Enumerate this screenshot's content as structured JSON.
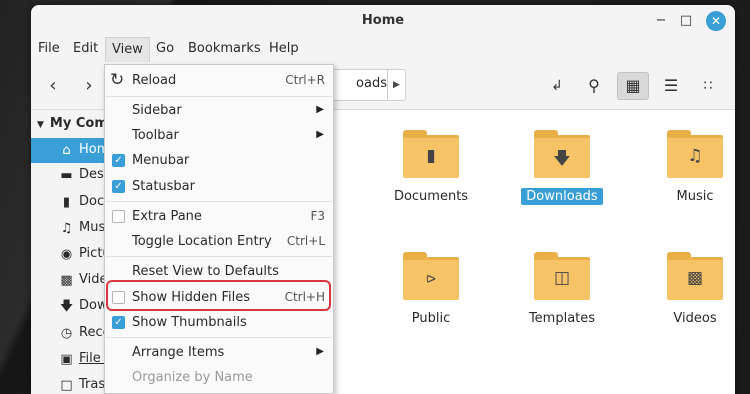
{
  "window": {
    "title": "Home"
  },
  "menubar": {
    "items": [
      "File",
      "Edit",
      "View",
      "Go",
      "Bookmarks",
      "Help"
    ]
  },
  "toolbar": {
    "back_icon": "chevron-left-icon",
    "forward_icon": "chevron-right-icon",
    "path_segment": "oads"
  },
  "sidebar": {
    "heading": "My Comp",
    "items": [
      {
        "label": "Home",
        "icon": "home-icon"
      },
      {
        "label": "Desk",
        "icon": "desktop-icon"
      },
      {
        "label": "Docu",
        "icon": "document-icon"
      },
      {
        "label": "Musi",
        "icon": "music-icon"
      },
      {
        "label": "Pictu",
        "icon": "camera-icon"
      },
      {
        "label": "Vide",
        "icon": "film-icon"
      },
      {
        "label": "Dow",
        "icon": "download-icon"
      },
      {
        "label": "Rece",
        "icon": "clock-icon"
      },
      {
        "label": "File S",
        "icon": "filesystem-icon"
      },
      {
        "label": "Tras",
        "icon": "trash-icon"
      }
    ]
  },
  "files": [
    {
      "name": "Documents",
      "glyph": "document-icon"
    },
    {
      "name": "Downloads",
      "glyph": "download-icon"
    },
    {
      "name": "Music",
      "glyph": "music-icon"
    },
    {
      "name": "Public",
      "glyph": "share-icon"
    },
    {
      "name": "Templates",
      "glyph": "template-icon"
    },
    {
      "name": "Videos",
      "glyph": "film-icon"
    }
  ],
  "view_menu": {
    "reload": {
      "label": "Reload",
      "accel": "Ctrl+R"
    },
    "sidebar": {
      "label": "Sidebar"
    },
    "toolbar": {
      "label": "Toolbar"
    },
    "menubar": {
      "label": "Menubar",
      "checked": true
    },
    "statusbar": {
      "label": "Statusbar",
      "checked": true
    },
    "extra_pane": {
      "label": "Extra Pane",
      "accel": "F3",
      "checked": false
    },
    "toggle_location": {
      "label": "Toggle Location Entry",
      "accel": "Ctrl+L"
    },
    "reset_view": {
      "label": "Reset View to Defaults"
    },
    "show_hidden": {
      "label": "Show Hidden Files",
      "accel": "Ctrl+H",
      "checked": false
    },
    "show_thumbnails": {
      "label": "Show Thumbnails",
      "checked": true
    },
    "arrange_items": {
      "label": "Arrange Items"
    },
    "organize_by_name": {
      "label": "Organize by Name"
    }
  },
  "colors": {
    "accent": "#3a9fd6",
    "folder": "#f6c467",
    "highlight": "#d9363e"
  }
}
